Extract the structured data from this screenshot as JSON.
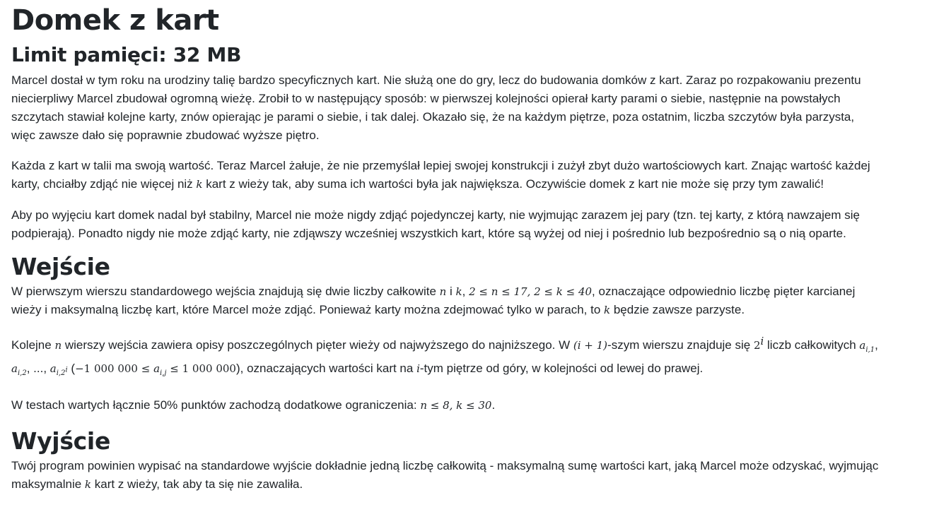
{
  "title": "Domek z kart",
  "memory_limit": "Limit pamięci: 32 MB",
  "intro": "Marcel dostał w tym roku na urodziny talię bardzo specyficznych kart. Nie służą one do gry, lecz do budowania domków z kart. Zaraz po rozpakowaniu prezentu niecierpliwy Marcel zbudował ogromną wieżę. Zrobił to w następujący sposób: w pierwszej kolejności opierał karty parami o siebie, następnie na powstałych szczytach stawiał kolejne karty, znów opierając je parami o siebie, i tak dalej. Okazało się, że na każdym piętrze, poza ostatnim, liczba szczytów była parzysta, więc zawsze dało się poprawnie zbudować wyższe piętro.",
  "value": {
    "part1": "Każda z kart w talii ma swoją wartość. Teraz Marcel żałuje, że nie przemyślał lepiej swojej konstrukcji i zużył zbyt dużo wartościowych kart. Znając wartość każdej karty, chciałby zdjąć nie więcej niż ",
    "k": "k",
    "part2": " kart z wieży tak, aby suma ich wartości była jak największa. Oczywiście domek z kart nie może się przy tym zawalić!"
  },
  "stability": "Aby po wyjęciu kart domek nadal był stabilny, Marcel nie może nigdy zdjąć pojedynczej karty, nie wyjmując zarazem jej pary (tzn. tej karty, z którą nawzajem się podpierają). Ponadto nigdy nie może zdjąć karty, nie zdjąwszy wcześniej wszystkich kart, które są wyżej od niej i pośrednio lub bezpośrednio są o nią oparte.",
  "input": {
    "heading": "Wejście",
    "p1": {
      "a": "W pierwszym wierszu standardowego wejścia znajdują się dwie liczby całkowite ",
      "n": "n",
      "b": " i ",
      "k": "k",
      "c": ", ",
      "constraint": "2 ≤ n ≤ 17, 2 ≤ k ≤ 40",
      "d": ", oznaczające odpowiednio liczbę pięter karcianej wieży i maksymalną liczbę kart, które Marcel może zdjąć. Ponieważ karty można zdejmować tylko w parach, to ",
      "k2": "k",
      "e": " będzie zawsze parzyste."
    },
    "p2": {
      "a": "Kolejne ",
      "n": "n",
      "b": " wierszy wejścia zawiera opisy poszczególnych pięter wieży od najwyższego do najniższego. W ",
      "row": "(i + 1)",
      "c": "-szym wierszu znajduje się ",
      "count_base": "2",
      "count_exp": "i",
      "d": " liczb całkowitych ",
      "a1": "a",
      "a1_sub": "i,1",
      "sep1": ", ",
      "a2": "a",
      "a2_sub": "i,2",
      "sep2": ", ..., ",
      "a3": "a",
      "a3_sub": "i,2",
      "a3_sup": "i",
      "e": " (",
      "range_lo": "−1 000 000 ≤ ",
      "range_var": "a",
      "range_sub": "i,j",
      "range_hi": " ≤ 1 000 000",
      "f": "), oznaczających wartości kart na ",
      "i": "i",
      "g": "-tym piętrze od góry, w kolejności od lewej do prawej."
    },
    "p3": {
      "a": "W testach wartych łącznie 50% punktów zachodzą dodatkowe ograniczenia: ",
      "constraint": "n ≤ 8, k ≤ 30",
      "b": "."
    }
  },
  "output": {
    "heading": "Wyjście",
    "p1": {
      "a": "Twój program powinien wypisać na standardowe wyjście dokładnie jedną liczbę całkowitą - maksymalną sumę wartości kart, jaką Marcel może odzyskać, wyjmując maksymalnie ",
      "k": "k",
      "b": " kart z wieży, tak aby ta się nie zawaliła."
    }
  }
}
